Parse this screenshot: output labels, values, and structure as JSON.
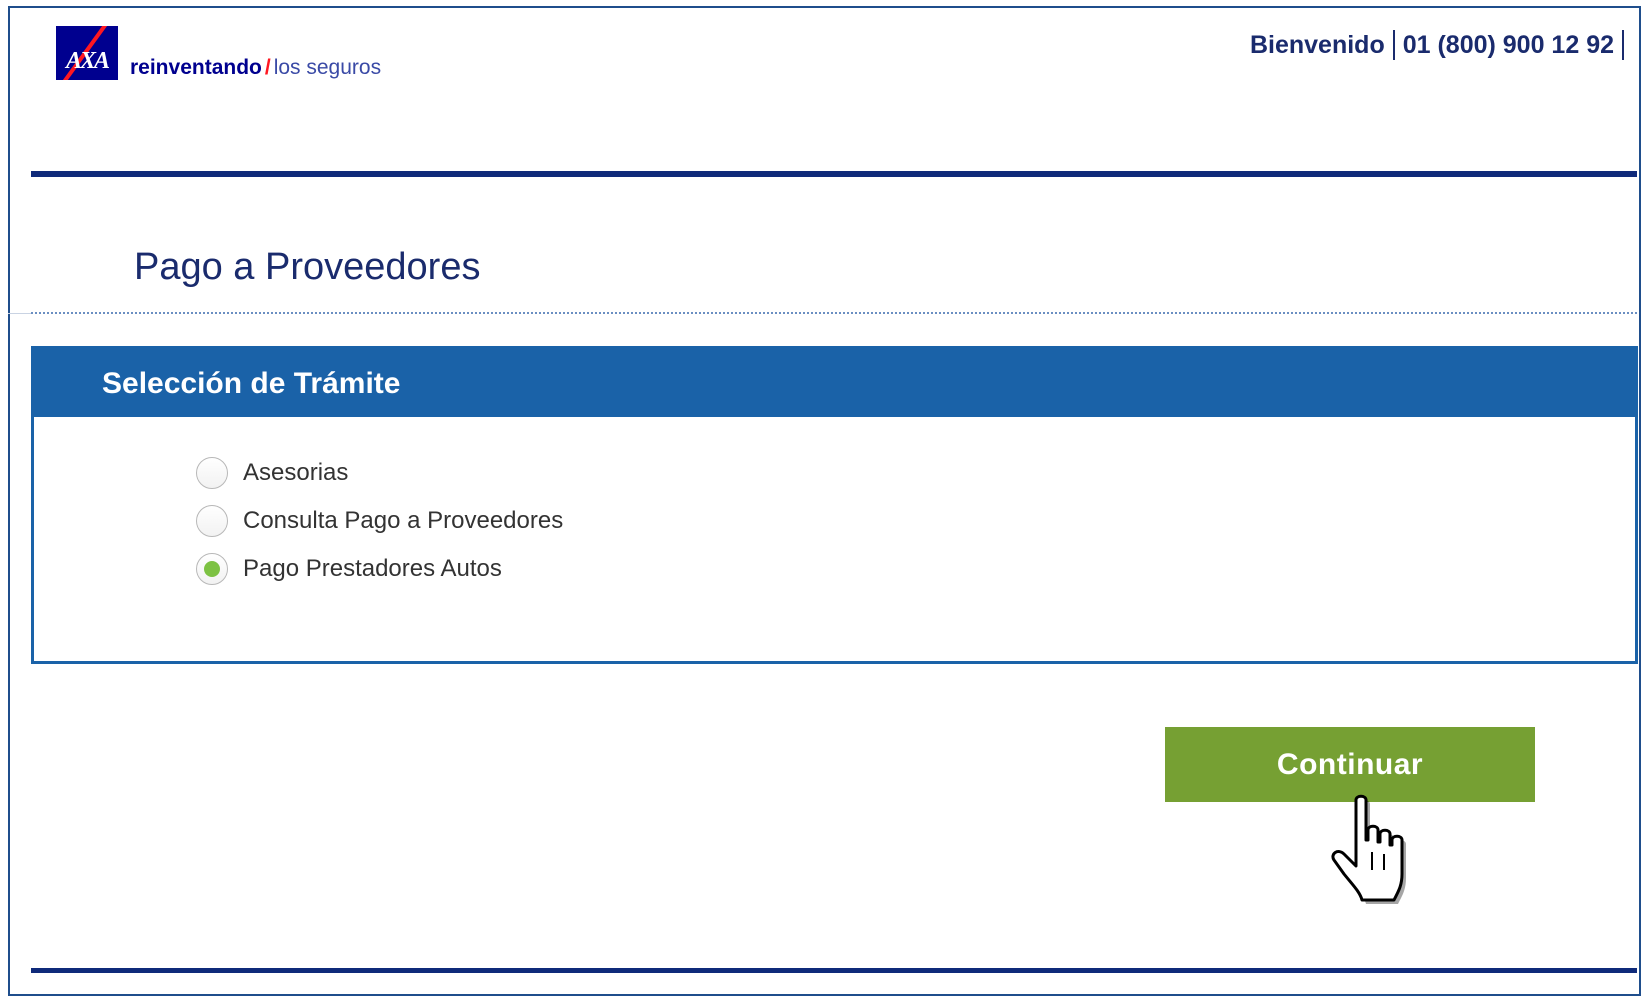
{
  "header": {
    "logo_text": "AXA",
    "tagline_bold": "reinventando",
    "tagline_slash": "/",
    "tagline_light": "los seguros",
    "welcome": "Bienvenido",
    "phone": "01 (800) 900 12 92"
  },
  "page": {
    "title": "Pago a Proveedores"
  },
  "panel": {
    "title": "Selección de Trámite",
    "options": [
      {
        "label": "Asesorias",
        "selected": false
      },
      {
        "label": "Consulta Pago a Proveedores",
        "selected": false
      },
      {
        "label": "Pago Prestadores Autos",
        "selected": true
      }
    ]
  },
  "actions": {
    "continue_label": "Continuar"
  },
  "colors": {
    "brand_blue": "#00008f",
    "brand_red": "#ff1721",
    "panel_blue": "#1a62a8",
    "button_green": "#76a033",
    "radio_selected": "#7dc243",
    "rule_navy": "#0f2a7a"
  }
}
